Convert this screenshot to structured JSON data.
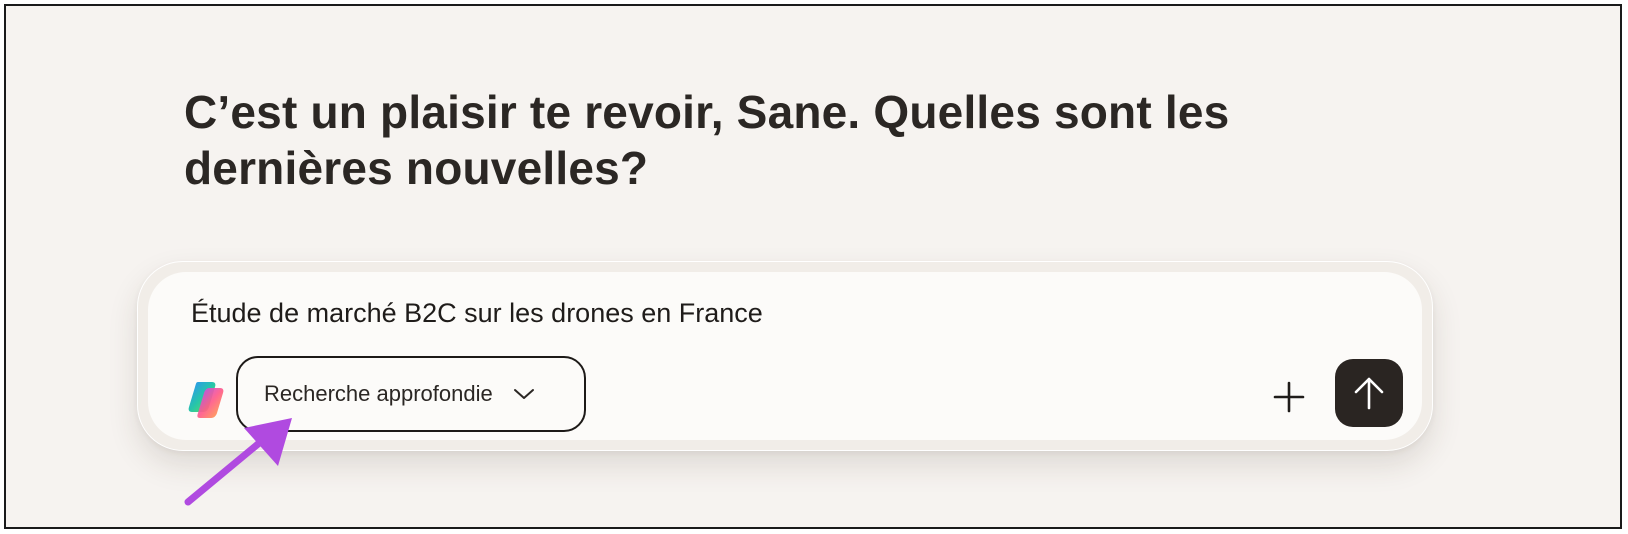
{
  "greeting": {
    "text": "C’est un plaisir te revoir, Sane. Quelles sont les dernières nouvelles?"
  },
  "composer": {
    "prompt_text": "Étude de marché B2C sur les drones en France",
    "mode_select": {
      "selected_label": "Recherche approfondie",
      "icon": "chevron-down-icon"
    },
    "logo_icon": "copilot-logo-icon",
    "add_icon": "plus-icon",
    "send_icon": "arrow-up-icon"
  },
  "annotation": {
    "arrow_color": "#b04ae0"
  },
  "colors": {
    "background": "#f6f3f0",
    "composer_bg": "#fcfbf9",
    "send_button_bg": "#2a2522",
    "text": "#2b2724"
  }
}
